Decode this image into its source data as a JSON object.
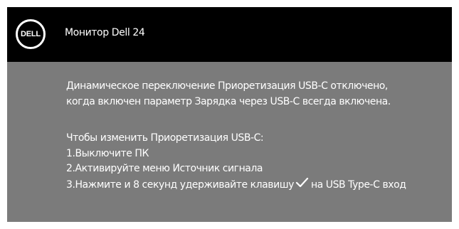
{
  "header": {
    "logo_text": "DELL",
    "title": "Монитор Dell 24"
  },
  "message": {
    "line1": "Динамическое переключение Приоретизация USB-C отключено,",
    "line2": "когда включен параметр Зарядка через USB-C всегда включена."
  },
  "instructions": {
    "intro": "Чтобы изменить Приоретизация USB-C:",
    "step1": "1.Выключите ПК",
    "step2": "2.Активируйте меню Источник сигнала",
    "step3_before": "3.Нажмите и 8 секунд удерживайте клавишу",
    "step3_icon": "check-icon",
    "step3_after": "на USB Type-C вход"
  },
  "colors": {
    "header_bg": "#000000",
    "panel_bg": "#7b7b7b",
    "text": "#ffffff"
  }
}
